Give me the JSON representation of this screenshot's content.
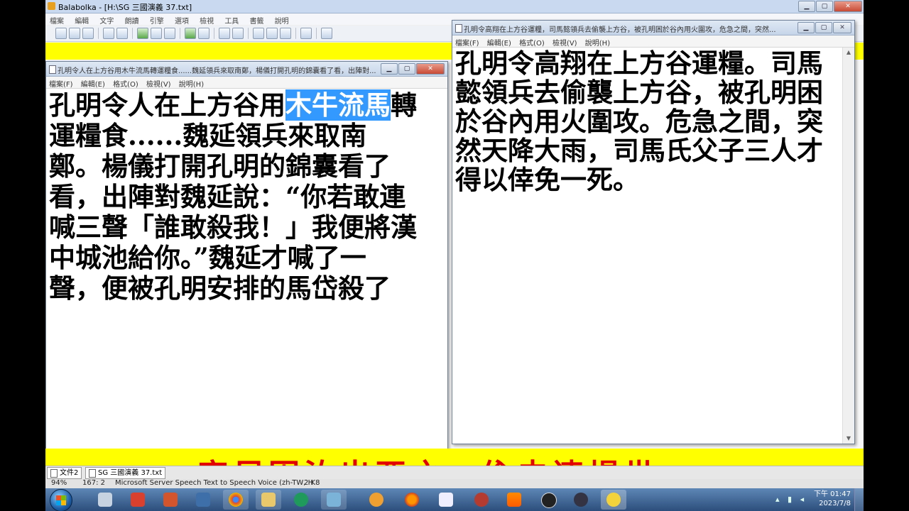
{
  "main_window": {
    "title": "Balabolka - [H:\\SG 三國演義 37.txt]",
    "menu": [
      "檔案",
      "編輯",
      "文字",
      "朗讀",
      "引擎",
      "選項",
      "檢視",
      "工具",
      "書籤",
      "說明"
    ]
  },
  "doc_window_left": {
    "title": "孔明令人在上方谷用木牛流馬轉運糧食......魏延領兵來取南鄭，楊儀打開孔明的錦囊看了看，出陣對...",
    "menu": [
      "檔案(F)",
      "編輯(E)",
      "格式(O)",
      "檢視(V)",
      "說明(H)"
    ],
    "text_before": "孔明令人在上方谷用",
    "text_selected": "木牛流馬",
    "text_after": "轉運糧食......魏延領兵來取南鄭。楊儀打開孔明的錦囊看了看，出陣對魏延說：“你若敢連喊三聲「誰敢殺我！」我便將漢中城池給你。”魏延才喊了一聲，便被孔明安排的馬岱殺了"
  },
  "doc_window_right": {
    "title": "孔明令高翔在上方谷運糧，司馬懿領兵去偷襲上方谷，被孔明困於谷內用火圍攻，危急之間，突然...",
    "menu": [
      "檔案(F)",
      "編輯(E)",
      "格式(O)",
      "檢視(V)",
      "說明(H)"
    ],
    "text": "孔明令高翔在上方谷運糧。司馬懿領兵去偷襲上方谷，被孔明困於谷內用火圍攻。危急之間，突然天降大雨，司馬氏父子三人才得以倖免一死。"
  },
  "banner_text": "...害尼困汝出亞之，偸去連場世",
  "tabs": [
    "文件2",
    "SG 三國演義 37.txt"
  ],
  "status_bar": {
    "zoom": "94%",
    "position": "167:  2",
    "voice": "Microsoft Server Speech Text to Speech Voice (zh-TW, H",
    "size": "2 K8"
  },
  "taskbar": {
    "apps": [
      "people-icon",
      "pdf-icon",
      "powerpoint-icon",
      "network-icon",
      "chrome-icon",
      "folder-icon",
      "recycle-icon",
      "pen-tablet-icon",
      "media-player-icon",
      "firefox-icon",
      "calculator-icon",
      "devil-icon",
      "vlc-icon",
      "obs-icon",
      "bird-icon",
      "balabolka-icon"
    ],
    "clock_time": "下午 01:47",
    "clock_date": "2023/7/8"
  }
}
